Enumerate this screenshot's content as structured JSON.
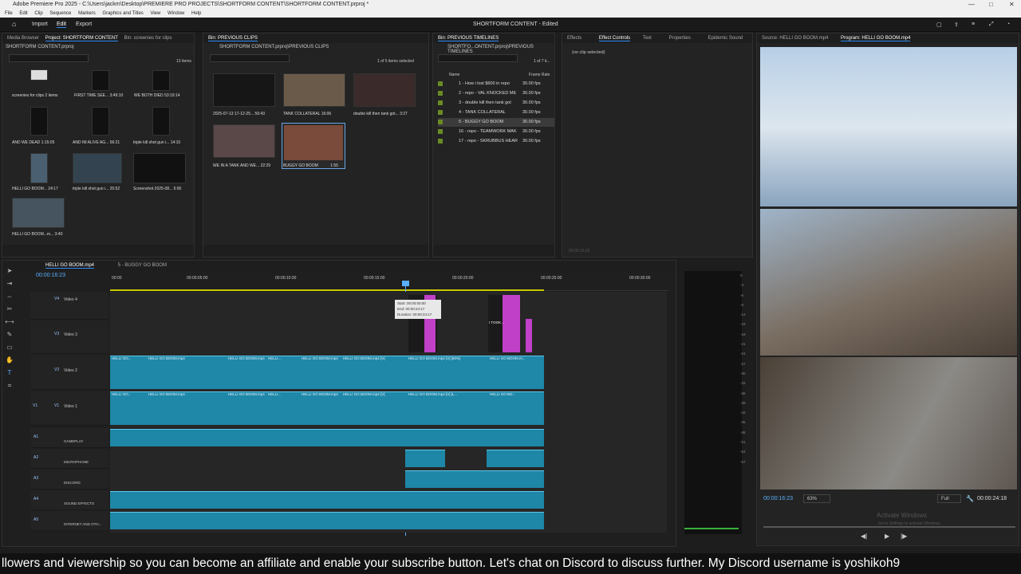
{
  "titlebar": {
    "title": "Adobe Premiere Pro 2025 - C:\\Users\\jackm\\Desktop\\PREMIERE PRO PROJECTS\\SHORTFORM CONTENT\\SHORTFORM CONTENT.prproj *"
  },
  "menu": [
    "File",
    "Edit",
    "Clip",
    "Sequence",
    "Markers",
    "Graphics and Titles",
    "View",
    "Window",
    "Help"
  ],
  "appbar": {
    "home": "home-icon",
    "import": "Import",
    "edit": "Edit",
    "export": "Export",
    "project": "SHORTFORM CONTENT - Edited"
  },
  "project_panel": {
    "tabs": [
      "Media Browser",
      "Project: SHORTFORM CONTENT",
      "Bin: screenies for clips"
    ],
    "path": "SHORTFORM CONTENT.prproj",
    "count": "13 items",
    "items": [
      {
        "name": "screenies for clips",
        "meta": "2 items"
      },
      {
        "name": "FIRST TIME SEE...",
        "meta": "3:49:10"
      },
      {
        "name": "WE BOTH DIED",
        "meta": "53:19:14"
      },
      {
        "name": "AND WE DEAD",
        "meta": "1:15:05"
      },
      {
        "name": "AND IM ALIVE AG...",
        "meta": "56:21"
      },
      {
        "name": "triple kill shot gun i...",
        "meta": "14:10"
      },
      {
        "name": "HELLI GO BOOM...",
        "meta": "24:17"
      },
      {
        "name": "triple kill shot gun i...",
        "meta": "20:52"
      },
      {
        "name": "Screenshot 2025-08...",
        "meta": "5:00"
      },
      {
        "name": "HELLI GO BOOM...m...",
        "meta": "3:40"
      }
    ]
  },
  "bin_clips": {
    "tab": "Bin: PREVIOUS CLIPS",
    "path": "SHORTFORM CONTENT.prproj\\PREVIOUS CLIPS",
    "count": "1 of 5 items selected",
    "items": [
      {
        "name": "2025-07-13 17-12-25...",
        "meta": "56:43"
      },
      {
        "name": "TANK COLLATERAL",
        "meta": "16:06"
      },
      {
        "name": "double kill then tank got...",
        "meta": "3:27"
      },
      {
        "name": "WE IN A TANK AND WE...",
        "meta": "22:29"
      },
      {
        "name": "BUGGY GO BOOM",
        "meta": "1:55"
      }
    ]
  },
  "bin_timelines": {
    "tab": "Bin: PREVIOUS TIMELINES",
    "path": "SHORTFO...ONTENT.prproj\\PREVIOUS TIMELINES",
    "count": "1 of 7 it...",
    "col_name": "Name",
    "col_rate": "Frame Rate",
    "rows": [
      {
        "name": "1 - How i lost $600 in repo",
        "rate": "30.00 fps"
      },
      {
        "name": "2 - repo - VAL KNOCKED ME",
        "rate": "30.00 fps"
      },
      {
        "name": "3 - double kill then tank got",
        "rate": "30.00 fps"
      },
      {
        "name": "4 - TANK COLLATERAL",
        "rate": "30.00 fps"
      },
      {
        "name": "5 - BUGGY GO BOOM",
        "rate": "30.00 fps"
      },
      {
        "name": "16 - repo - TEAMWORK MAK",
        "rate": "30.00 fps"
      },
      {
        "name": "17 - repo - SKRUBBUS HEAR",
        "rate": "30.00 fps"
      }
    ]
  },
  "effects_panel": {
    "tabs": [
      "Effects",
      "Effect Controls",
      "Text",
      "Properties",
      "Epidemic Sound"
    ],
    "status": "(no clip selected)",
    "timecode": "00:00:16:23"
  },
  "program": {
    "tabs": [
      "Source: HELLI GO BOOM.mp4",
      "Program: HELLI GO BOOM.mp4"
    ],
    "timecode": "00:00:16:23",
    "zoom": "63%",
    "quality": "Full",
    "duration": "00:00:24:18",
    "watermark1": "Activate Windows",
    "watermark2": "Go to Settings to activate Windows."
  },
  "timeline": {
    "tabs": [
      "HELLI GO BOOM.mp4",
      "5 - BUGGY GO BOOM"
    ],
    "timecode": "00:00:16:23",
    "ruler": [
      "00:00",
      "00:00:05:00",
      "00:00:10:00",
      "00:00:15:00",
      "00:00:20:00",
      "00:00:25:00",
      "00:00:30:00"
    ],
    "tooltip": {
      "start": "Start: 00:00:00:00",
      "end": "End: 00:00:24:17",
      "dur": "Duration: 00:00:24:17"
    },
    "video_tracks": [
      {
        "id": "V4",
        "name": "Video 4"
      },
      {
        "id": "V3",
        "name": "Video 3"
      },
      {
        "id": "V2",
        "name": "Video 2"
      },
      {
        "id": "V1",
        "name": "Video 1"
      }
    ],
    "audio_tracks": [
      {
        "id": "A1",
        "name": "GAMEPLAY"
      },
      {
        "id": "A2",
        "name": "MICROPHONE"
      },
      {
        "id": "A3",
        "name": "DISCORD"
      },
      {
        "id": "A4",
        "name": "SOUND EFFECTS"
      },
      {
        "id": "A5",
        "name": "INTERNET AND OTH..."
      }
    ],
    "v2_labels": [
      "HELLI GO...",
      "HELLI GO BOOM.mp4",
      "HELLI GO BOOM.mp4",
      "HELLI...",
      "HELLI GO BOOM.mp4",
      "HELLI GO BOOM.mp4 [V]",
      "HELLI GO BOOM.mp4 [V] [50%]",
      "HELLI GO BOOM.m..."
    ],
    "v1_labels": [
      "HELLI GO...",
      "HELLI GO BOOM.mp4",
      "HELLI GO BOOM.mp4",
      "HELLI...",
      "HELLI GO BOOM.mp4",
      "HELLI GO BOOM.mp4 [V]",
      "HELLI GO BOOM.mp4 [V] [L...",
      "HELLI GO BO..."
    ],
    "v3_title": "I TOOK...",
    "meter_scale": [
      "0",
      "-3",
      "-6",
      "-9",
      "-12",
      "-15",
      "-18",
      "-21",
      "-24",
      "-27",
      "-30",
      "-33",
      "-36",
      "-39",
      "-42",
      "-45",
      "-48",
      "-51",
      "-54",
      "-57"
    ]
  },
  "subtitle": "llowers and viewership so you can become an affiliate and enable your subscribe button. Let's chat on Discord to discuss further. My Discord username is yoshikoh9"
}
